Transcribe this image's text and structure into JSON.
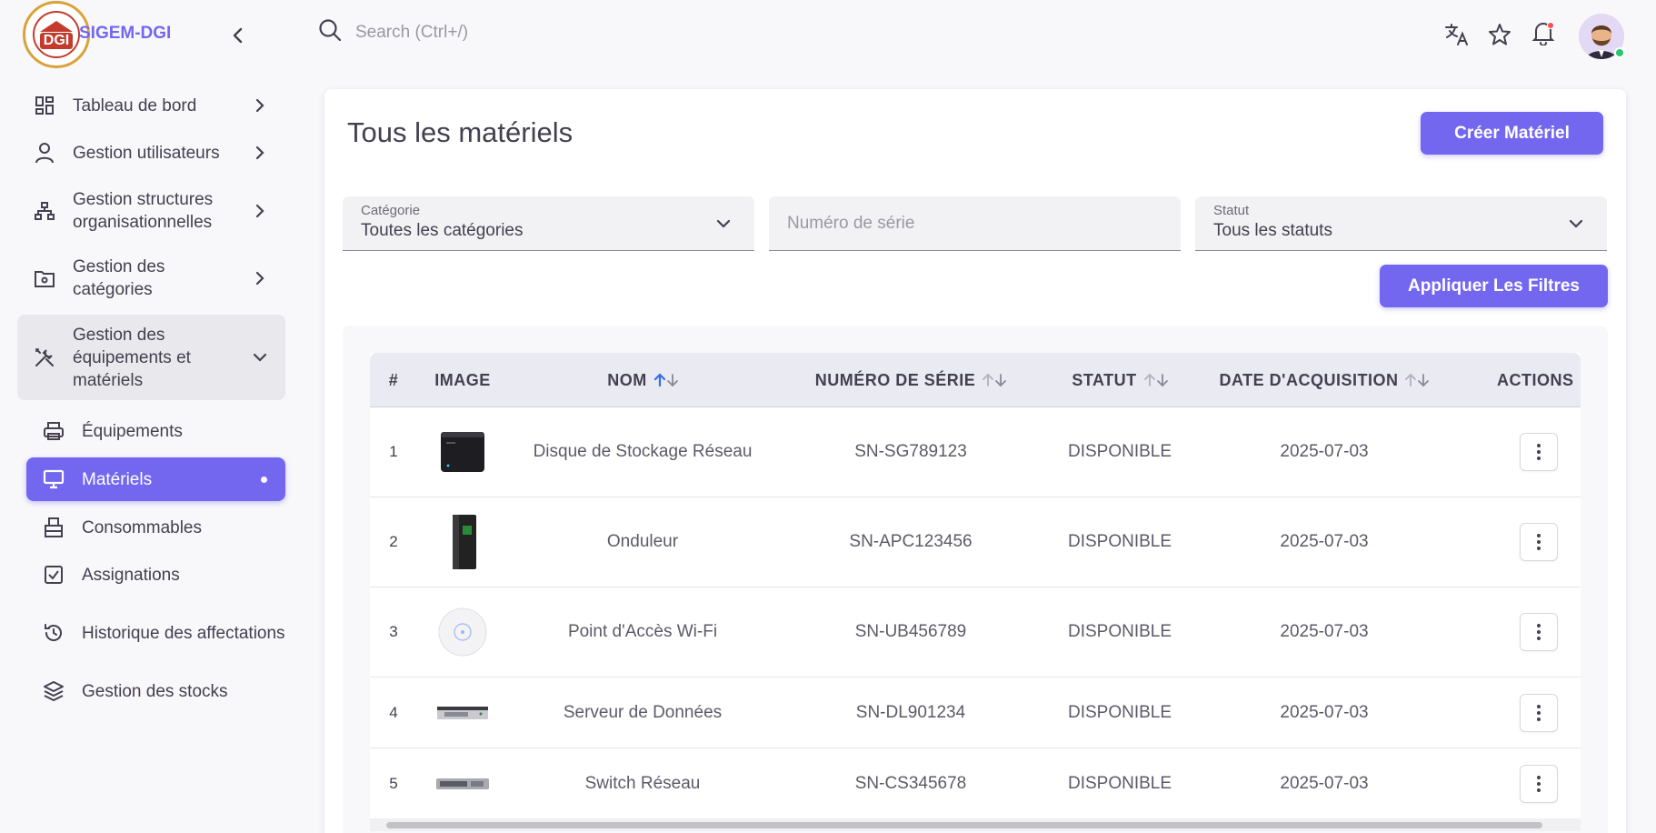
{
  "brand": {
    "name": "SIGEM-DGI",
    "logo_text": "DGI"
  },
  "search": {
    "placeholder": "Search (Ctrl+/)"
  },
  "sidebar": {
    "items": [
      {
        "label": "Tableau de bord",
        "icon": "dashboard-icon"
      },
      {
        "label": "Gestion utilisateurs",
        "icon": "user-icon"
      },
      {
        "label": "Gestion structures organisationnelles",
        "icon": "hierarchy-icon"
      },
      {
        "label": "Gestion des catégories",
        "icon": "folder-settings-icon"
      },
      {
        "label": "Gestion des équipements et matériels",
        "icon": "tools-icon"
      }
    ],
    "subitems": [
      {
        "label": "Équipements",
        "icon": "printer-icon"
      },
      {
        "label": "Matériels",
        "icon": "monitor-icon",
        "active": true
      },
      {
        "label": "Consommables",
        "icon": "consumable-icon"
      },
      {
        "label": "Assignations",
        "icon": "checkbox-icon"
      },
      {
        "label": "Historique des affectations",
        "icon": "history-icon"
      },
      {
        "label": "Gestion des stocks",
        "icon": "layers-icon"
      }
    ]
  },
  "page": {
    "title": "Tous les matériels",
    "create_label": "Créer Matériel",
    "apply_filters_label": "Appliquer Les Filtres"
  },
  "filters": {
    "category": {
      "label": "Catégorie",
      "value": "Toutes les catégories"
    },
    "serial": {
      "placeholder": "Numéro de série"
    },
    "status": {
      "label": "Statut",
      "value": "Tous les statuts"
    }
  },
  "table": {
    "columns": [
      "#",
      "IMAGE",
      "NOM",
      "NUMÉRO DE SÉRIE",
      "STATUT",
      "DATE D'ACQUISITION",
      "ACTIONS"
    ],
    "rows": [
      {
        "index": "1",
        "name": "Disque de Stockage Réseau",
        "serial": "SN-SG789123",
        "status": "DISPONIBLE",
        "date": "2025-07-03",
        "image": "nas-image"
      },
      {
        "index": "2",
        "name": "Onduleur",
        "serial": "SN-APC123456",
        "status": "DISPONIBLE",
        "date": "2025-07-03",
        "image": "ups-image"
      },
      {
        "index": "3",
        "name": "Point d'Accès Wi-Fi",
        "serial": "SN-UB456789",
        "status": "DISPONIBLE",
        "date": "2025-07-03",
        "image": "access-point-image"
      },
      {
        "index": "4",
        "name": "Serveur de Données",
        "serial": "SN-DL901234",
        "status": "DISPONIBLE",
        "date": "2025-07-03",
        "image": "server-image"
      },
      {
        "index": "5",
        "name": "Switch Réseau",
        "serial": "SN-CS345678",
        "status": "DISPONIBLE",
        "date": "2025-07-03",
        "image": "switch-image"
      }
    ]
  },
  "colors": {
    "primary": "#7367f0",
    "text": "#444050",
    "sort_active": "#2f6fe8",
    "online": "#28c76f",
    "notification": "#ff4c51"
  }
}
